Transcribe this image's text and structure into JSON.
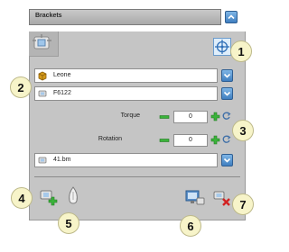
{
  "header": {
    "title": "Brackets"
  },
  "selectors": {
    "manufacturer": "Leone",
    "product": "F6122",
    "file": "41.bm"
  },
  "adjustments": {
    "torque_label": "Torque",
    "torque_value": "0",
    "rotation_label": "Rotation",
    "rotation_value": "0"
  },
  "callouts": [
    "1",
    "2",
    "3",
    "4",
    "5",
    "6",
    "7"
  ],
  "colors": {
    "panel": "#c5c5c5",
    "accent_blue": "#3f7fc0",
    "callout_fill": "#f7f4c9",
    "add_green": "#3bb33b",
    "remove_red": "#d22222"
  }
}
